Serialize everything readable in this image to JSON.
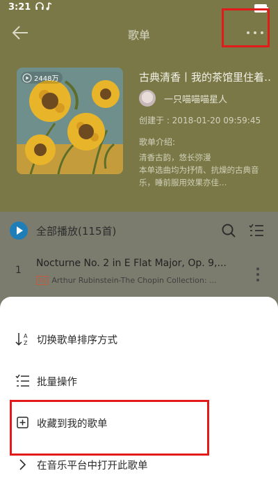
{
  "status": {
    "time": "3:21"
  },
  "header": {
    "title": "歌单",
    "playlist_title": "古典清香丨我的茶馆里住着…",
    "play_count": "2448万",
    "creator": "一只喵喵喵星人",
    "created_at": "创建于 : 2018-01-20 09:59:45",
    "intro_label": "歌单介绍:",
    "intro_lines": [
      "清香古韵，悠长弥漫",
      "本单选曲均为抒情、抗燥的古典音",
      "乐，睡前服用效果亦佳…"
    ]
  },
  "list": {
    "play_all": "全部播放(115首)",
    "songs": [
      {
        "index": "1",
        "title": "Nocturne No. 2 in E Flat Major, Op. 9,...",
        "quality": "SQ",
        "meta": "Arthur Rubinstein-The Chopin Collection: ..."
      }
    ]
  },
  "sheet": {
    "items": [
      {
        "label": "切换歌单排序方式",
        "icon": "sort-az-icon"
      },
      {
        "label": "批量操作",
        "icon": "checklist-icon"
      },
      {
        "label": "收藏到我的歌单",
        "icon": "add-square-icon"
      },
      {
        "label": "在音乐平台中打开此歌单",
        "icon": "chevron-right-icon"
      }
    ]
  },
  "colors": {
    "highlight": "#e21a1a",
    "accent": "#1f7db8",
    "header_bg": "#7a7846"
  }
}
